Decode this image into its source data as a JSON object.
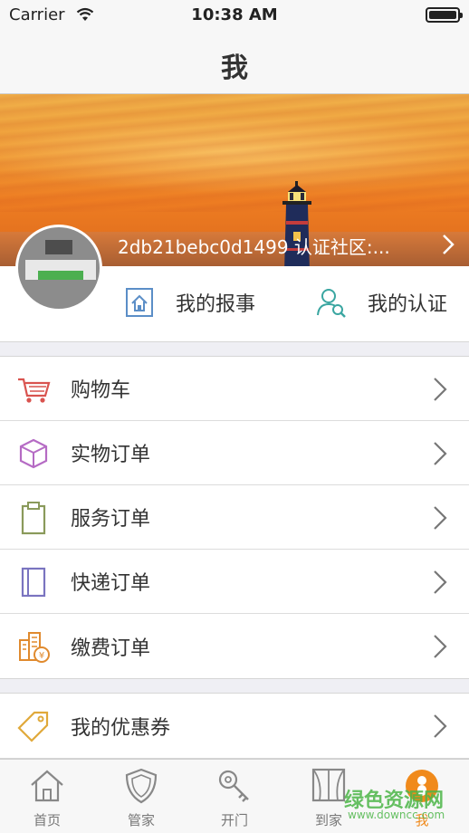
{
  "status_bar": {
    "carrier": "Carrier",
    "time": "10:38 AM"
  },
  "nav": {
    "title": "我"
  },
  "profile": {
    "user_info": "2db21bebc0d1499 认证社区:..."
  },
  "quick_actions": [
    {
      "label": "我的报事",
      "icon": "house-document-icon"
    },
    {
      "label": "我的认证",
      "icon": "user-search-icon"
    }
  ],
  "menu_group_1": [
    {
      "label": "购物车",
      "icon": "cart-icon"
    },
    {
      "label": "实物订单",
      "icon": "box-icon"
    },
    {
      "label": "服务订单",
      "icon": "clipboard-icon"
    },
    {
      "label": "快递订单",
      "icon": "notebook-icon"
    },
    {
      "label": "缴费订单",
      "icon": "building-yen-icon"
    }
  ],
  "menu_group_2": [
    {
      "label": "我的优惠券",
      "icon": "tag-icon"
    }
  ],
  "tabs": [
    {
      "label": "首页",
      "icon": "home-icon"
    },
    {
      "label": "管家",
      "icon": "shield-icon"
    },
    {
      "label": "开门",
      "icon": "key-icon"
    },
    {
      "label": "到家",
      "icon": "window-icon"
    },
    {
      "label": "我",
      "icon": "person-icon",
      "active": true
    }
  ],
  "watermark": {
    "text": "绿色资源网",
    "url": "www.downcc.com"
  },
  "colors": {
    "accent": "#f08a1c",
    "watermark": "#4cb648"
  }
}
